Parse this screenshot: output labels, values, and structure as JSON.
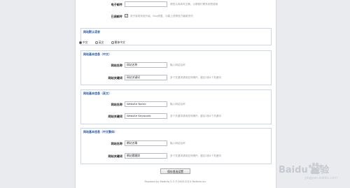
{
  "top": {
    "email_label": "电子邮件",
    "email_value": "",
    "email_hint": "请您认真填写正确，以便我们联系到您使用",
    "notify_label": "已阅邮件",
    "notify_text": "用于接收系统升级、Bug修复、功能上线等官方最新资讯"
  },
  "language": {
    "title": "网站默认语言",
    "options": [
      "中文",
      "英文",
      "繁体中文"
    ],
    "selected": "中文"
  },
  "cn": {
    "title": "网站基本信息（中文）",
    "name_label": "网站名称",
    "name_value": "网站名称",
    "name_hint": "输入网站名称",
    "kw_label": "网站关键词",
    "kw_value": "网站关键词",
    "kw_hint": "多个关键词请用逗号隔开，建议3到4个关键词"
  },
  "en": {
    "title": "网站基本信息（英文）",
    "name_label": "网站名称",
    "name_value": "Website Name",
    "name_hint": "输入网站名称",
    "kw_label": "网站关键词",
    "kw_value": "Website Keywords",
    "kw_hint": "多个关键词请用逗号隔开，建议3到4个关键词"
  },
  "tw": {
    "title": "网站基本信息（中文繁体）",
    "name_label": "网站名称",
    "name_value": "網站名稱",
    "name_hint": "输入网站名称",
    "kw_label": "网站关键词",
    "kw_value": "網站關鍵詞",
    "kw_hint": "多个关键词请用逗号隔开，建议3到4个关键词"
  },
  "save_label": "保存首选设置",
  "footer": "Powered by MetInfo 5.3 ©2008-2015 MetInfo Inc.",
  "watermark": "Baidu 经验",
  "watermark_sub": "jingyan.baidu.com"
}
